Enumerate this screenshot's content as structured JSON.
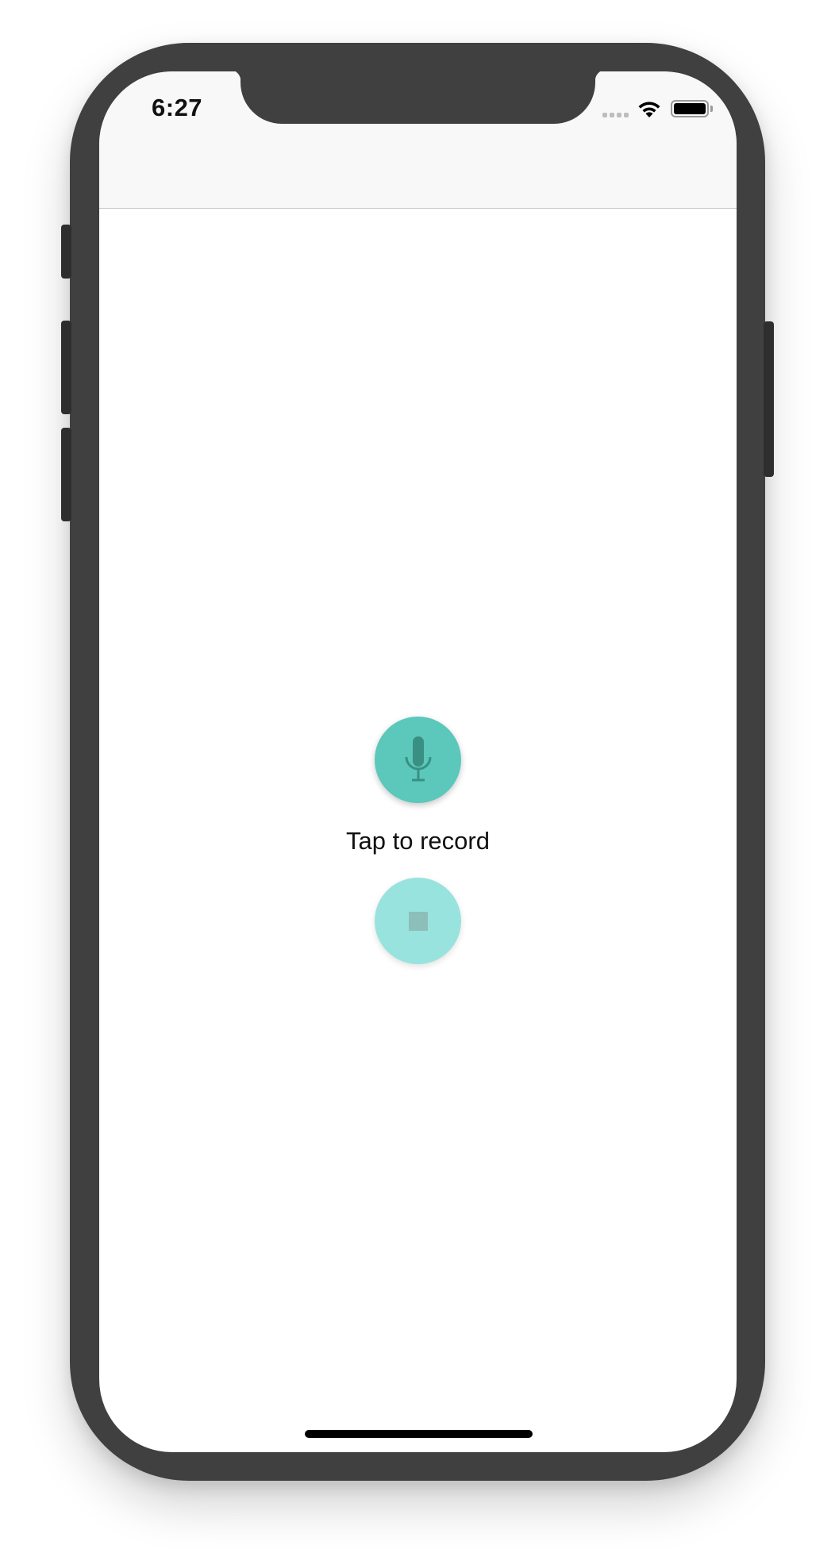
{
  "status_bar": {
    "time": "6:27"
  },
  "main": {
    "record_label": "Tap to record"
  },
  "icons": {
    "record": "microphone-icon",
    "stop": "stop-icon",
    "wifi": "wifi-icon",
    "battery": "battery-icon",
    "signal": "cellular-signal-icon"
  },
  "colors": {
    "accent": "#5bc8bb",
    "accent_disabled": "#98e3dd",
    "navbar_background": "#f8f8f8",
    "device_frame": "#404040"
  }
}
